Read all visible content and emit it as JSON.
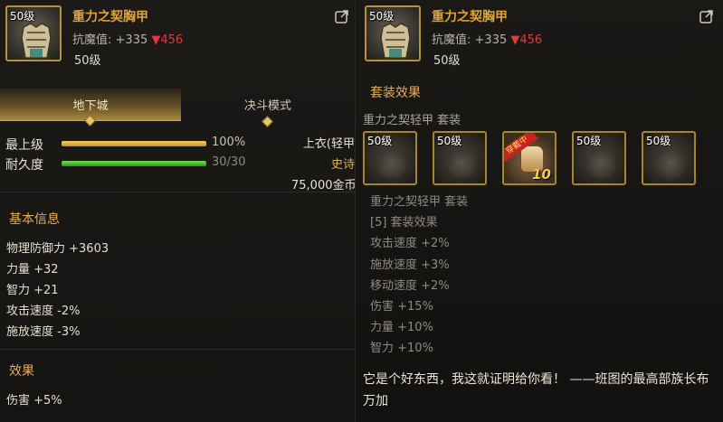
{
  "item": {
    "level_badge": "50级",
    "name": "重力之契胸甲",
    "stat_label": "抗魔值:",
    "stat_value": "+335",
    "stat_delta": "▼456",
    "level": "50级"
  },
  "tabs": [
    {
      "label": "地下城",
      "active": true
    },
    {
      "label": "决斗模式",
      "active": false
    }
  ],
  "bars": [
    {
      "label": "最上级",
      "value_text": "100%",
      "fraction": 1.0,
      "color": "#f2c240"
    },
    {
      "label": "耐久度",
      "value_text": "30/30",
      "fraction": 1.0,
      "color": "#4cc22e"
    }
  ],
  "slot_info": {
    "type": "上衣(轻甲",
    "rarity": "史诗",
    "price": "75,000金币"
  },
  "basic_info": {
    "title": "基本信息",
    "stats": [
      "物理防御力 +3603",
      "力量 +32",
      "智力 +21",
      "攻击速度 -2%",
      "施放速度 -3%"
    ]
  },
  "effects": {
    "title": "效果",
    "stats": [
      "伤害 +5%"
    ]
  },
  "set": {
    "title": "套装效果",
    "name": "重力之契轻甲 套装",
    "slots": [
      {
        "level": "50级",
        "active": false
      },
      {
        "level": "50级",
        "active": false
      },
      {
        "level": "",
        "active": true,
        "badge": "穿戴中",
        "count": "10"
      },
      {
        "level": "50级",
        "active": false
      },
      {
        "level": "50级",
        "active": false
      }
    ],
    "effects": [
      "重力之契轻甲 套装",
      "[5] 套装效果",
      "攻击速度 +2%",
      "施放速度 +3%",
      "移动速度 +2%",
      "伤害 +15%",
      "力量 +10%",
      "智力 +10%"
    ]
  },
  "flavor_text": "它是个好东西，我这就证明给你看！ ——班图的最高部族长布万加",
  "colors": {
    "item_name": "#e0a33a",
    "section_title": "#e3b05a",
    "delta": "#e03a3a",
    "frame": "#b8923a"
  }
}
